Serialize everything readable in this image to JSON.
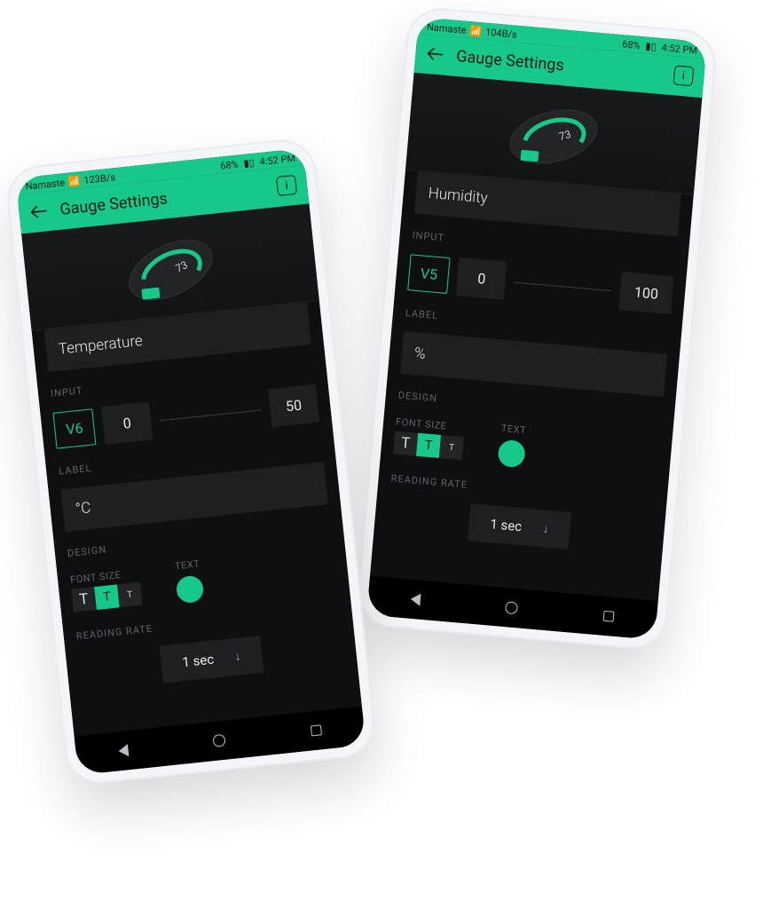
{
  "status": {
    "carrier": "Namaste",
    "speed_left": "123B/s",
    "speed_right": "104B/s",
    "battery": "68%",
    "time": "4:52 PM"
  },
  "header": {
    "title": "Gauge Settings"
  },
  "gauge_preview_value": "73",
  "sections": {
    "input": "INPUT",
    "label": "LABEL",
    "design": "DESIGN",
    "fontsize": "FONT SIZE",
    "text": "TEXT",
    "reading_rate": "READING RATE"
  },
  "fontsize_opts": {
    "big": "T",
    "med": "T",
    "sml": "T"
  },
  "reading_rate_value": "1 sec",
  "phones": {
    "left": {
      "name_value": "Temperature",
      "pin": "V6",
      "min": "0",
      "max": "50",
      "label_value": "°C"
    },
    "right": {
      "name_value": "Humidity",
      "pin": "V5",
      "min": "0",
      "max": "100",
      "label_value": "%"
    }
  },
  "colors": {
    "accent": "#16c98a"
  }
}
